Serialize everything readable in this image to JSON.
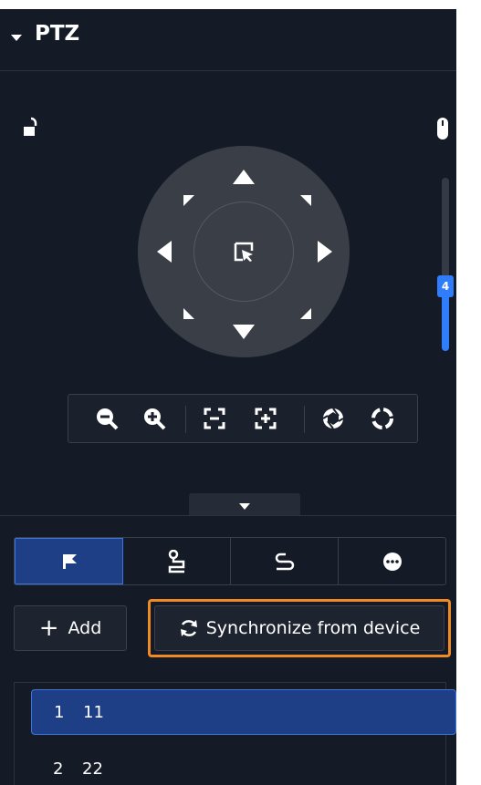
{
  "panel": {
    "title": "PTZ",
    "collapse_icon": "caret-down-icon"
  },
  "status_icons": {
    "lock": "unlock-icon",
    "mouse": "mouse-icon"
  },
  "joystick": {
    "directions": [
      "up",
      "up-right",
      "right",
      "down-right",
      "down",
      "down-left",
      "left",
      "up-left"
    ],
    "center": "select-pointer-icon"
  },
  "speed_slider": {
    "value": 4,
    "max": 8,
    "min": 1
  },
  "toolbar": {
    "buttons": [
      "zoom-out-icon",
      "zoom-in-icon",
      "focus-near-icon",
      "focus-far-icon",
      "iris-open-icon",
      "iris-close-icon"
    ]
  },
  "tabs": [
    {
      "icon": "flag-icon",
      "active": true
    },
    {
      "icon": "tour-path-icon",
      "active": false
    },
    {
      "icon": "pattern-icon",
      "active": false
    },
    {
      "icon": "more-icon",
      "active": false
    }
  ],
  "actions": {
    "add_label": "Add",
    "sync_label": "Synchronize from device"
  },
  "presets": [
    {
      "num": "1",
      "name": "11",
      "selected": true
    },
    {
      "num": "2",
      "name": "22",
      "selected": false
    }
  ],
  "colors": {
    "background": "#151b26",
    "accent": "#2f7dfa",
    "selected": "#1e3f85",
    "highlight": "#f08a24"
  }
}
